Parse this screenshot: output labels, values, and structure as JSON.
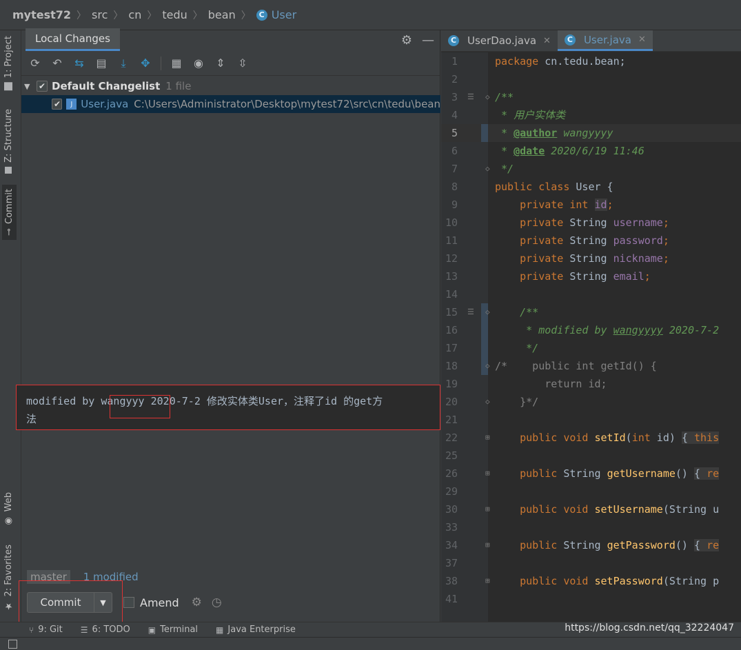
{
  "breadcrumb": [
    "mytest72",
    "src",
    "cn",
    "tedu",
    "bean",
    "User"
  ],
  "left_strip": {
    "project": "1: Project",
    "structure": "Z: Structure",
    "commit": "Commit",
    "web": "Web",
    "favorites": "2: Favorites"
  },
  "panel": {
    "tab": "Local Changes",
    "changelist_name": "Default Changelist",
    "changelist_count": "1 file",
    "file_name": "User.java",
    "file_path": "C:\\Users\\Administrator\\Desktop\\mytest72\\src\\cn\\tedu\\bean",
    "commit_message_line1": "modified by wangyyy 2020-7-2 修改实体类User，注释了id 的get方",
    "commit_message_line2": "法",
    "branch": "master",
    "modified": "1 modified",
    "commit_label": "Commit",
    "amend_label": "Amend"
  },
  "editor": {
    "tabs": [
      "UserDao.java",
      "User.java"
    ],
    "active_tab": "User.java",
    "line_numbers": [
      "1",
      "2",
      "3",
      "4",
      "5",
      "6",
      "7",
      "8",
      "9",
      "10",
      "11",
      "12",
      "13",
      "14",
      "15",
      "16",
      "17",
      "18",
      "19",
      "20",
      "21",
      "22",
      "25",
      "26",
      "29",
      "30",
      "33",
      "34",
      "37",
      "38",
      "41"
    ]
  },
  "bottom_bar": {
    "git": "9: Git",
    "todo": "6: TODO",
    "terminal": "Terminal",
    "java_enterprise": "Java Enterprise",
    "watermark": "https://blog.csdn.net/qq_32224047"
  }
}
